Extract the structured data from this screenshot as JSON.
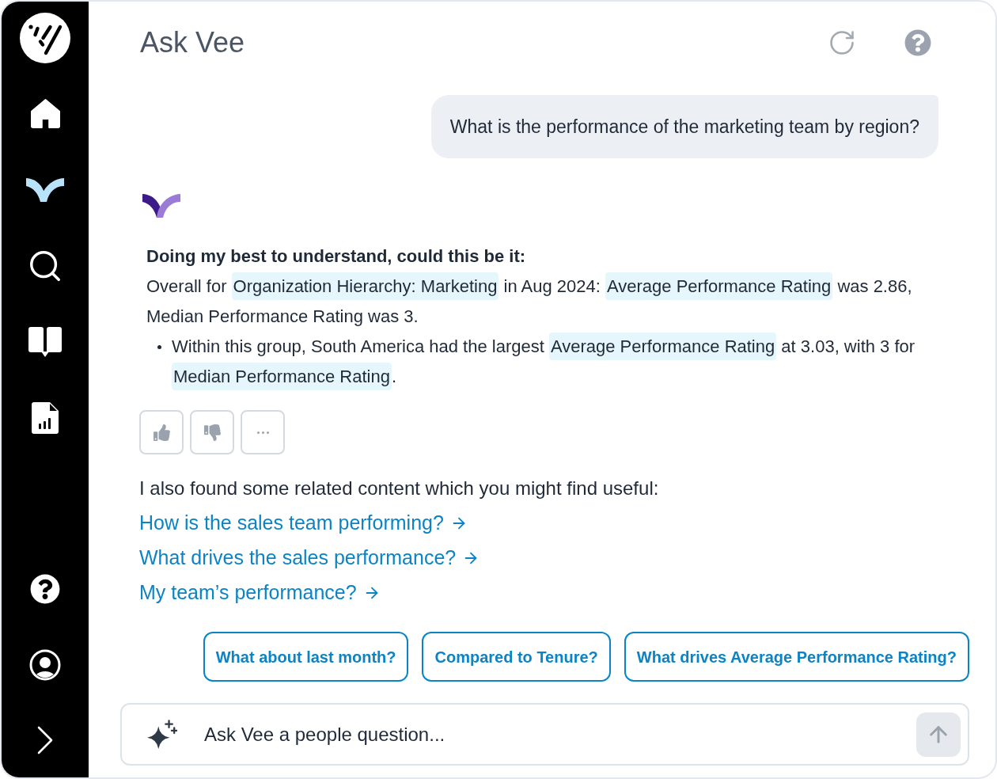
{
  "sidebar": {
    "nav_items": [
      {
        "selected": false
      },
      {
        "selected": true
      },
      {
        "selected": false
      },
      {
        "selected": false
      },
      {
        "selected": false
      }
    ]
  },
  "header": {
    "title": "Ask Vee"
  },
  "user_message": "What is the performance of the marketing team by region?",
  "response": {
    "heading": "Doing my best to understand, could this be it:",
    "summary": [
      {
        "kind": "plain",
        "text": "Overall for "
      },
      {
        "kind": "term",
        "text": "Organization Hierarchy: Marketing"
      },
      {
        "kind": "plain",
        "text": " in Aug 2024: "
      },
      {
        "kind": "term",
        "text": "Average Performance Rating"
      },
      {
        "kind": "plain",
        "text": " was 2.86, Median Performance Rating was 3."
      }
    ],
    "bullets": [
      [
        {
          "kind": "plain",
          "text": "Within this group, South America had the largest "
        },
        {
          "kind": "term",
          "text": "Average Performance Rating"
        },
        {
          "kind": "plain",
          "text": " at 3.03, with 3 for "
        },
        {
          "kind": "term",
          "text": "Median Performance Rating"
        },
        {
          "kind": "plain",
          "text": "."
        }
      ]
    ]
  },
  "related": {
    "intro": "I also found some related content which you might find useful:",
    "links": [
      "How is the sales team performing?",
      "What drives the sales performance?",
      "My team’s performance?"
    ]
  },
  "suggestions": [
    "What about last month?",
    "Compared to Tenure?",
    "What drives Average Performance Rating?"
  ],
  "composer": {
    "placeholder": "Ask Vee a people question..."
  }
}
